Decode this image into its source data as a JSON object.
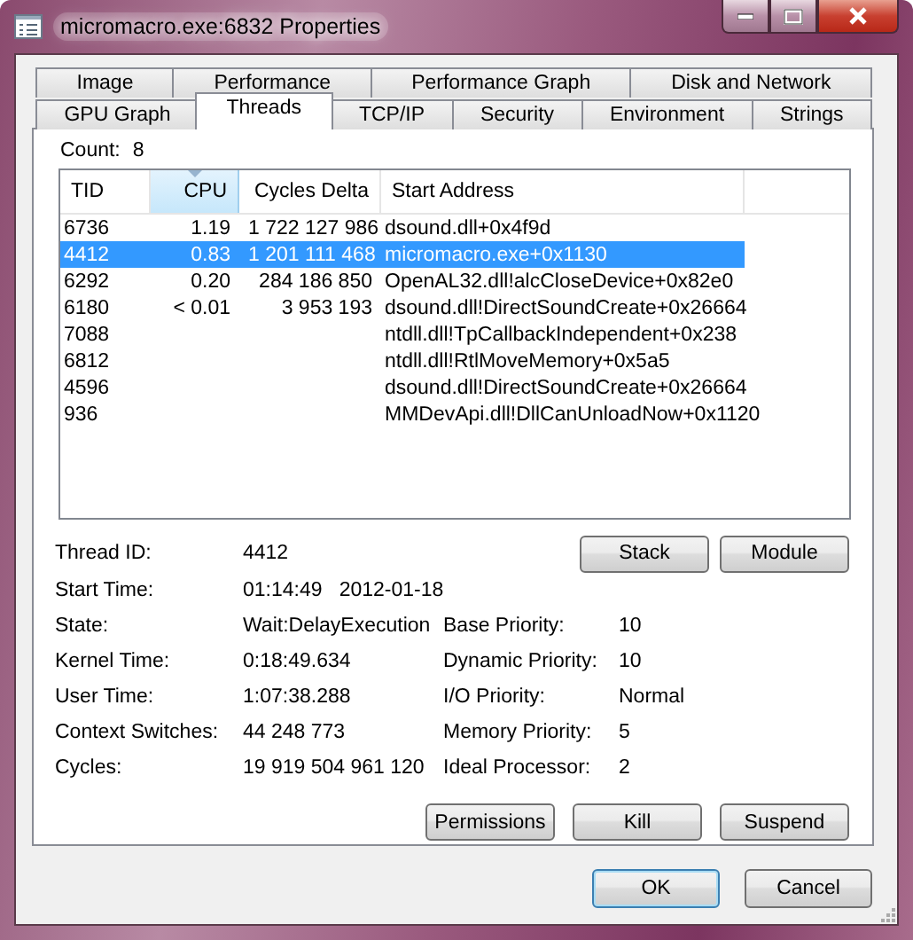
{
  "window": {
    "title": "micromacro.exe:6832 Properties"
  },
  "tabs": [
    [
      {
        "label": "Image",
        "selected": false
      },
      {
        "label": "Performance",
        "selected": false
      },
      {
        "label": "Performance Graph",
        "selected": false
      },
      {
        "label": "Disk and Network",
        "selected": false
      }
    ],
    [
      {
        "label": "GPU Graph",
        "selected": false
      },
      {
        "label": "Threads",
        "selected": true
      },
      {
        "label": "TCP/IP",
        "selected": false
      },
      {
        "label": "Security",
        "selected": false
      },
      {
        "label": "Environment",
        "selected": false
      },
      {
        "label": "Strings",
        "selected": false
      }
    ]
  ],
  "count": {
    "label": "Count:",
    "value": "8"
  },
  "threads": {
    "columns": [
      {
        "label": "TID",
        "sorted": false
      },
      {
        "label": "CPU",
        "sorted": true
      },
      {
        "label": "Cycles Delta",
        "sorted": false
      },
      {
        "label": "Start Address",
        "sorted": false
      }
    ],
    "rows": [
      {
        "cells": [
          "6736",
          "1.19",
          "1 722 127 986",
          "dsound.dll+0x4f9d"
        ],
        "selected": false
      },
      {
        "cells": [
          "4412",
          "0.83",
          "1 201 111 468",
          "micromacro.exe+0x1130"
        ],
        "selected": true
      },
      {
        "cells": [
          "6292",
          "0.20",
          "284 186 850",
          "OpenAL32.dll!alcCloseDevice+0x82e0"
        ],
        "selected": false
      },
      {
        "cells": [
          "6180",
          "< 0.01",
          "3 953 193",
          "dsound.dll!DirectSoundCreate+0x26664"
        ],
        "selected": false
      },
      {
        "cells": [
          "7088",
          "",
          "",
          "ntdll.dll!TpCallbackIndependent+0x238"
        ],
        "selected": false
      },
      {
        "cells": [
          "6812",
          "",
          "",
          "ntdll.dll!RtlMoveMemory+0x5a5"
        ],
        "selected": false
      },
      {
        "cells": [
          "4596",
          "",
          "",
          "dsound.dll!DirectSoundCreate+0x26664"
        ],
        "selected": false
      },
      {
        "cells": [
          "936",
          "",
          "",
          "MMDevApi.dll!DllCanUnloadNow+0x1120"
        ],
        "selected": false
      }
    ]
  },
  "details": [
    {
      "label": "Thread ID:",
      "value": "4412"
    },
    {
      "label": "Start Time:",
      "value": "01:14:49   2012-01-18"
    },
    {
      "label": "State:",
      "value": "Wait:DelayExecution"
    },
    {
      "label": "Kernel Time:",
      "value": "0:18:49.634"
    },
    {
      "label": "User Time:",
      "value": "1:07:38.288"
    },
    {
      "label": "Context Switches:",
      "value": "44 248 773"
    },
    {
      "label": "Cycles:",
      "value": "19 919 504 961 120"
    }
  ],
  "priorities": [
    {
      "label": "Base Priority:",
      "value": "10"
    },
    {
      "label": "Dynamic Priority:",
      "value": "10"
    },
    {
      "label": "I/O Priority:",
      "value": "Normal"
    },
    {
      "label": "Memory Priority:",
      "value": "5"
    },
    {
      "label": "Ideal Processor:",
      "value": "2"
    }
  ],
  "thread_buttons": [
    "Stack",
    "Module"
  ],
  "action_buttons": [
    "Permissions",
    "Kill",
    "Suspend"
  ],
  "dialog_buttons": [
    {
      "label": "OK",
      "default": true
    },
    {
      "label": "Cancel",
      "default": false
    }
  ]
}
